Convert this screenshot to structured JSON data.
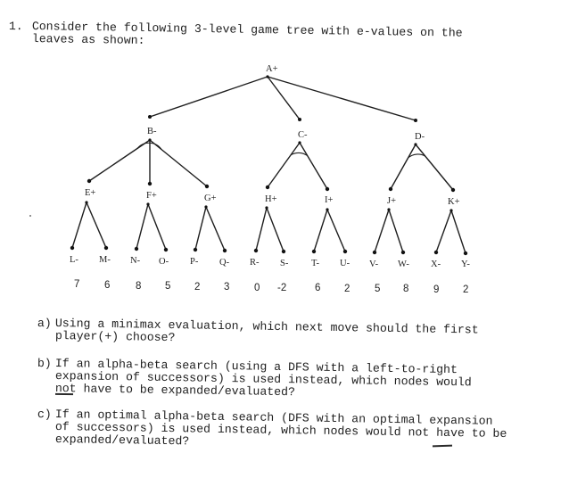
{
  "question": {
    "number": "1.",
    "line1": "Consider the following 3-level game tree with e-values on the",
    "line2": "leaves as shown:"
  },
  "tree": {
    "root": {
      "id": "A",
      "label": "A+",
      "player": "max"
    },
    "level1": [
      {
        "id": "B",
        "label": "B-",
        "player": "min",
        "children": [
          "E",
          "F",
          "G"
        ]
      },
      {
        "id": "C",
        "label": "C-",
        "player": "min",
        "children": [
          "H",
          "I"
        ]
      },
      {
        "id": "D",
        "label": "D-",
        "player": "min",
        "children": [
          "J",
          "K"
        ]
      }
    ],
    "level2": [
      {
        "id": "E",
        "label": "E+",
        "player": "max",
        "children": [
          "L",
          "M"
        ]
      },
      {
        "id": "F",
        "label": "F+",
        "player": "max",
        "children": [
          "N",
          "O"
        ]
      },
      {
        "id": "G",
        "label": "G+",
        "player": "max",
        "children": [
          "P",
          "Q"
        ]
      },
      {
        "id": "H",
        "label": "H+",
        "player": "max",
        "children": [
          "R",
          "S"
        ]
      },
      {
        "id": "I",
        "label": "I+",
        "player": "max",
        "children": [
          "T",
          "U"
        ]
      },
      {
        "id": "J",
        "label": "J+",
        "player": "max",
        "children": [
          "V",
          "W"
        ]
      },
      {
        "id": "K",
        "label": "K+",
        "player": "max",
        "children": [
          "X",
          "Y"
        ]
      }
    ],
    "leaves": [
      {
        "id": "L",
        "label": "L-",
        "value": "7"
      },
      {
        "id": "M",
        "label": "M-",
        "value": "6"
      },
      {
        "id": "N",
        "label": "N-",
        "value": "8"
      },
      {
        "id": "O",
        "label": "O-",
        "value": "5"
      },
      {
        "id": "P",
        "label": "P-",
        "value": "2"
      },
      {
        "id": "Q",
        "label": "Q-",
        "value": "3"
      },
      {
        "id": "R",
        "label": "R-",
        "value": "0"
      },
      {
        "id": "S",
        "label": "S-",
        "value": "-2"
      },
      {
        "id": "T",
        "label": "T-",
        "value": "6"
      },
      {
        "id": "U",
        "label": "U-",
        "value": "2"
      },
      {
        "id": "V",
        "label": "V-",
        "value": "5"
      },
      {
        "id": "W",
        "label": "W-",
        "value": "8"
      },
      {
        "id": "X",
        "label": "X-",
        "value": "9"
      },
      {
        "id": "Y",
        "label": "Y-",
        "value": "2"
      }
    ]
  },
  "subquestions": [
    {
      "label": "a)",
      "lines": [
        "Using a minimax evaluation, which next move should the first",
        "player(+) choose?"
      ]
    },
    {
      "label": "b)",
      "lines": [
        "If an alpha-beta search (using a DFS with a left-to-right",
        "expansion of successors) is used instead, which nodes would",
        "not have to be expanded/evaluated?"
      ]
    },
    {
      "label": "c)",
      "lines": [
        "If an optimal alpha-beta search (DFS with an optimal expansion",
        "of successors) is used instead, which nodes would not have to be",
        "expanded/evaluated?"
      ]
    }
  ]
}
